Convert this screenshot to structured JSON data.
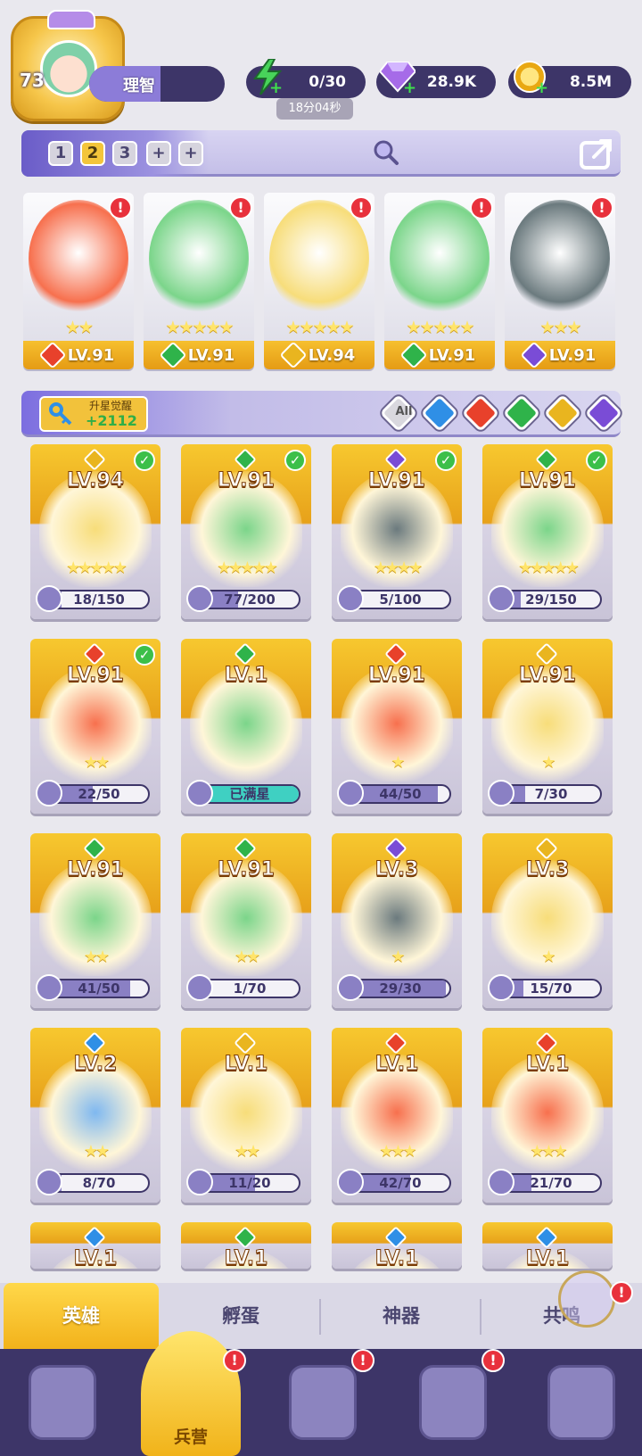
{
  "player": {
    "level": "73",
    "name": "理智"
  },
  "resources": {
    "energy": "0/30",
    "energy_timer": "18分04秒",
    "gems": "28.9K",
    "gold": "8.5M"
  },
  "team_tabs": [
    "1",
    "2",
    "3",
    "+",
    "+"
  ],
  "team_tab_active": "2",
  "team": [
    {
      "level": "LV.91",
      "stars": "★★",
      "element": "fire"
    },
    {
      "level": "LV.91",
      "stars": "★★★★★",
      "element": "nature"
    },
    {
      "level": "LV.94",
      "stars": "★★★★★",
      "element": "light"
    },
    {
      "level": "LV.91",
      "stars": "★★★★★",
      "element": "nature"
    },
    {
      "level": "LV.91",
      "stars": "★★★",
      "element": "dark"
    }
  ],
  "awaken": {
    "label": "升星觉醒",
    "value": "+2112"
  },
  "filters": [
    "All",
    "water",
    "fire",
    "nature",
    "light",
    "dark"
  ],
  "heroes": [
    {
      "level": "LV.94",
      "stars": "★★★★★",
      "shards": "18/150",
      "element": "light",
      "check": true
    },
    {
      "level": "LV.91",
      "stars": "★★★★★",
      "shards": "77/200",
      "element": "nature",
      "check": true
    },
    {
      "level": "LV.91",
      "stars": "★★★★",
      "shards": "5/100",
      "element": "dark",
      "check": true
    },
    {
      "level": "LV.91",
      "stars": "★★★★★",
      "shards": "29/150",
      "element": "nature",
      "check": true
    },
    {
      "level": "LV.91",
      "stars": "★★",
      "shards": "22/50",
      "element": "fire",
      "check": true
    },
    {
      "level": "LV.1",
      "stars": "",
      "shards": "已满星",
      "element": "nature",
      "check": false
    },
    {
      "level": "LV.91",
      "stars": "★",
      "shards": "44/50",
      "element": "fire",
      "check": false
    },
    {
      "level": "LV.91",
      "stars": "★",
      "shards": "7/30",
      "element": "light",
      "check": false
    },
    {
      "level": "LV.91",
      "stars": "★★",
      "shards": "41/50",
      "element": "nature",
      "check": false
    },
    {
      "level": "LV.91",
      "stars": "★★",
      "shards": "1/70",
      "element": "nature",
      "check": false
    },
    {
      "level": "LV.3",
      "stars": "★",
      "shards": "29/30",
      "element": "dark",
      "check": false
    },
    {
      "level": "LV.3",
      "stars": "★",
      "shards": "15/70",
      "element": "light",
      "check": false
    },
    {
      "level": "LV.2",
      "stars": "★★",
      "shards": "8/70",
      "element": "water",
      "check": false
    },
    {
      "level": "LV.1",
      "stars": "★★",
      "shards": "11/20",
      "element": "light",
      "check": false
    },
    {
      "level": "LV.1",
      "stars": "★★★",
      "shards": "42/70",
      "element": "fire",
      "check": false
    },
    {
      "level": "LV.1",
      "stars": "★★★",
      "shards": "21/70",
      "element": "fire",
      "check": false
    },
    {
      "level": "LV.1",
      "element": "water"
    },
    {
      "level": "LV.1",
      "element": "nature"
    },
    {
      "level": "LV.1",
      "element": "water"
    },
    {
      "level": "LV.1",
      "element": "water"
    }
  ],
  "sub_tabs": [
    "英雄",
    "孵蛋",
    "神器",
    "共鸣"
  ],
  "nav": {
    "center_label": "兵营"
  },
  "colors": {
    "fire": "#e8412b",
    "nature": "#2fb34a",
    "light": "#e9b51f",
    "dark": "#7a4cd6",
    "water": "#2f8fe6",
    "accent": "#f3c53a"
  }
}
